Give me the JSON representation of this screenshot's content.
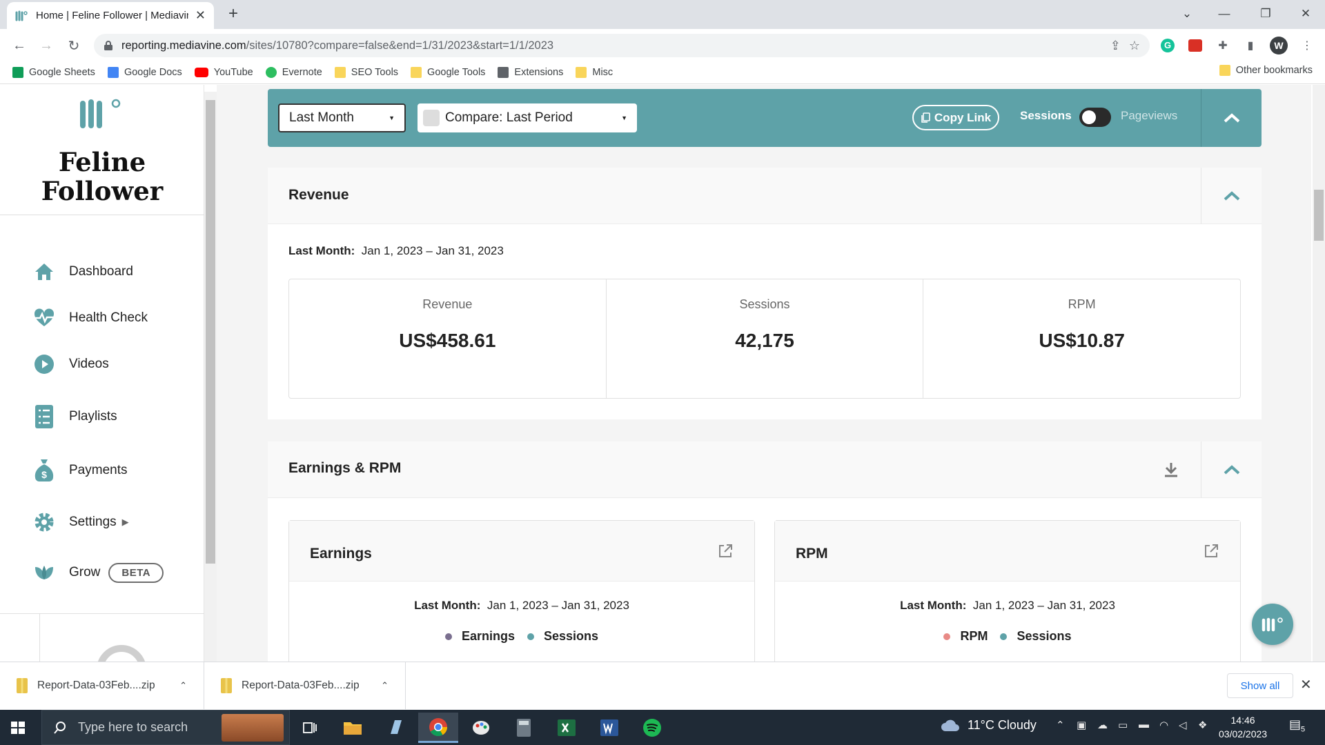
{
  "browser": {
    "tab_title": "Home | Feline Follower | Mediavine",
    "url_host": "reporting.mediavine.com",
    "url_path": "/sites/10780?compare=false&end=1/31/2023&start=1/1/2023",
    "profile_initial": "W",
    "bookmarks": [
      {
        "label": "Google Sheets",
        "color": "#0f9d58"
      },
      {
        "label": "Google Docs",
        "color": "#4285f4"
      },
      {
        "label": "YouTube",
        "color": "#ff0000"
      },
      {
        "label": "Evernote",
        "color": "#2dbe60"
      },
      {
        "label": "SEO Tools",
        "color": "#f9d55a"
      },
      {
        "label": "Google Tools",
        "color": "#f9d55a"
      },
      {
        "label": "Extensions",
        "color": "#5f6368"
      },
      {
        "label": "Misc",
        "color": "#f9d55a"
      }
    ],
    "other_bookmarks": "Other bookmarks"
  },
  "sidebar": {
    "site_name": "Feline Follower",
    "items": [
      {
        "label": "Dashboard",
        "icon": "home-icon"
      },
      {
        "label": "Health Check",
        "icon": "heartbeat-icon"
      },
      {
        "label": "Videos",
        "icon": "play-icon"
      },
      {
        "label": "Playlists",
        "icon": "list-icon"
      },
      {
        "label": "Payments",
        "icon": "money-bag-icon"
      },
      {
        "label": "Settings",
        "icon": "gear-icon"
      },
      {
        "label": "Grow",
        "icon": "leaf-icon",
        "badge": "BETA"
      }
    ]
  },
  "filters": {
    "range": "Last Month",
    "compare": "Compare: Last Period",
    "copy_link": "Copy Link",
    "toggle_left": "Sessions",
    "toggle_right": "Pageviews"
  },
  "revenue": {
    "title": "Revenue",
    "range_label": "Last Month:",
    "range_value": "Jan 1, 2023 – Jan 31, 2023",
    "stats": [
      {
        "label": "Revenue",
        "value": "US$458.61"
      },
      {
        "label": "Sessions",
        "value": "42,175"
      },
      {
        "label": "RPM",
        "value": "US$10.87"
      }
    ]
  },
  "earnings_rpm": {
    "title": "Earnings & RPM",
    "earnings": {
      "title": "Earnings",
      "range_label": "Last Month:",
      "range_value": "Jan 1, 2023 – Jan 31, 2023",
      "legend": [
        {
          "label": "Earnings",
          "color": "#7a6f8f"
        },
        {
          "label": "Sessions",
          "color": "#5ea2a8"
        }
      ]
    },
    "rpm": {
      "title": "RPM",
      "range_label": "Last Month:",
      "range_value": "Jan 1, 2023 – Jan 31, 2023",
      "legend": [
        {
          "label": "RPM",
          "color": "#e88a86"
        },
        {
          "label": "Sessions",
          "color": "#5ea2a8"
        }
      ]
    }
  },
  "downloads": {
    "items": [
      "Report-Data-03Feb....zip",
      "Report-Data-03Feb....zip"
    ],
    "show_all": "Show all"
  },
  "taskbar": {
    "search_placeholder": "Type here to search",
    "weather": "11°C  Cloudy",
    "time": "14:46",
    "date": "03/02/2023",
    "notifications": "5"
  },
  "colors": {
    "accent": "#5ea2a8",
    "text": "#222222"
  }
}
